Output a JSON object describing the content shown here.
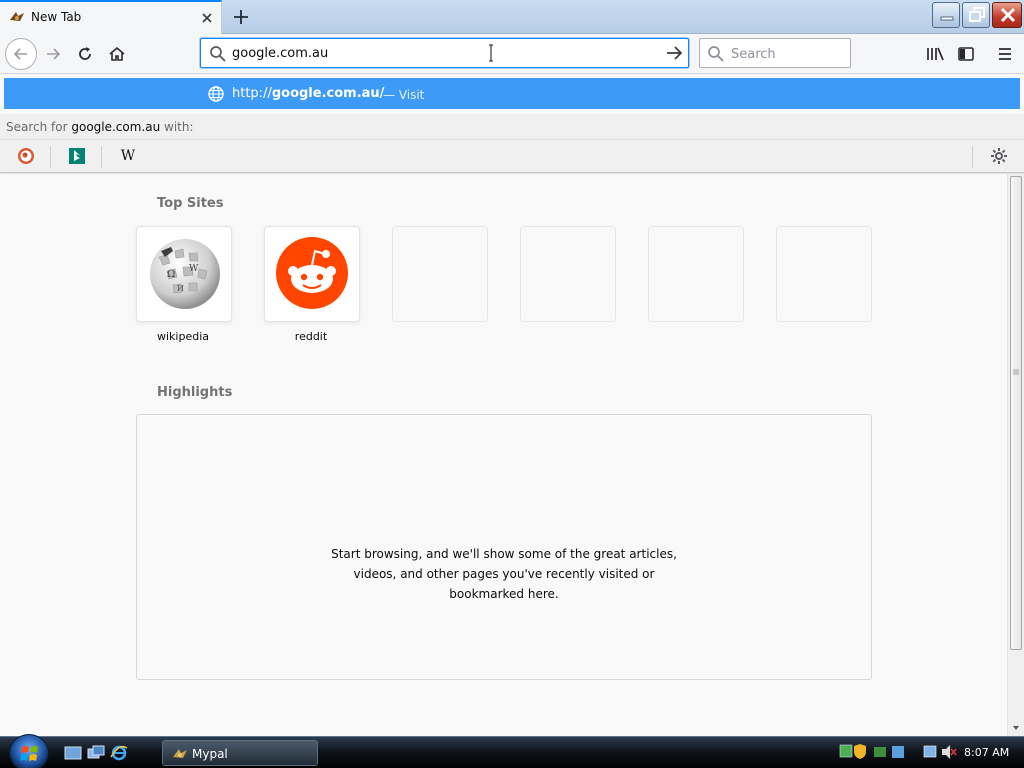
{
  "tab": {
    "title": "New Tab",
    "favicon": "pal-moth-icon"
  },
  "nav": {
    "url": "google.com.au",
    "search_placeholder": "Search"
  },
  "autocomplete": {
    "url_prefix": "http://",
    "url_host": "google.com.au/",
    "action": "— Visit",
    "search_for_prefix": "Search for ",
    "search_for_query": "google.com.au",
    "search_for_suffix": " with:",
    "engines": [
      "duckduckgo-icon",
      "bing-icon",
      "wikipedia-icon"
    ],
    "wikipedia_glyph": "W"
  },
  "content": {
    "top_sites_title": "Top Sites",
    "top_sites": [
      {
        "label": "wikipedia",
        "icon": "wikipedia-globe-icon"
      },
      {
        "label": "reddit",
        "icon": "reddit-icon"
      },
      {
        "label": "",
        "icon": ""
      },
      {
        "label": "",
        "icon": ""
      },
      {
        "label": "",
        "icon": ""
      },
      {
        "label": "",
        "icon": ""
      }
    ],
    "highlights_title": "Highlights",
    "highlights_line1": "Start browsing, and we'll show some of the great articles,",
    "highlights_line2": "videos, and other pages you've recently visited or",
    "highlights_line3": "bookmarked here."
  },
  "taskbar": {
    "task_label": "Mypal",
    "clock": "8:07 AM"
  },
  "colors": {
    "accent": "#0a84ff",
    "popup_selected": "#3d9af6",
    "reddit": "#ff4500"
  }
}
